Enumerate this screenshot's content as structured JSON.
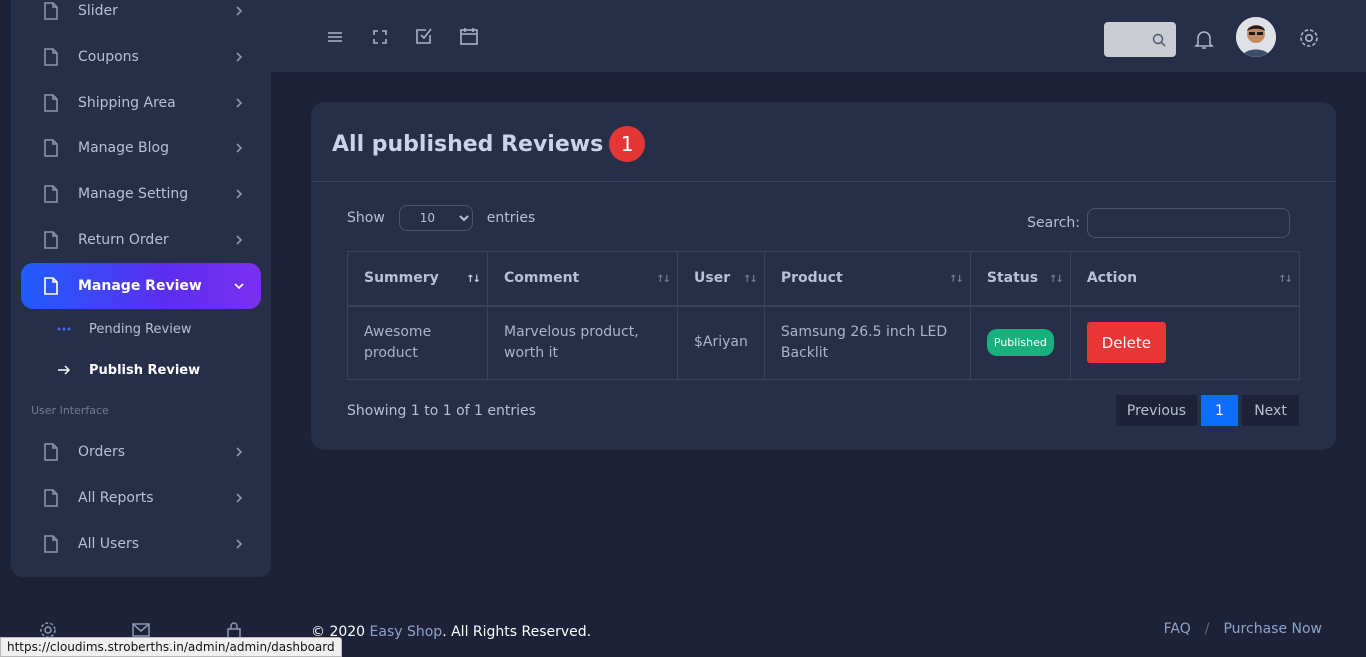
{
  "sidebar": {
    "items": [
      {
        "label": "Slider"
      },
      {
        "label": "Coupons"
      },
      {
        "label": "Shipping Area"
      },
      {
        "label": "Manage Blog"
      },
      {
        "label": "Manage Setting"
      },
      {
        "label": "Return Order"
      },
      {
        "label": "Manage Review"
      }
    ],
    "sub_items": [
      {
        "label": "Pending Review"
      },
      {
        "label": "Publish Review"
      }
    ],
    "section_label": "User Interface",
    "items2": [
      {
        "label": "Orders"
      },
      {
        "label": "All Reports"
      },
      {
        "label": "All Users"
      }
    ]
  },
  "card": {
    "title": "All published Reviews",
    "count": "1",
    "show_label": "Show",
    "entries_label": "entries",
    "page_size": "10",
    "search_label": "Search:"
  },
  "table": {
    "headers": [
      "Summery",
      "Comment",
      "User",
      "Product",
      "Status",
      "Action"
    ],
    "rows": [
      {
        "summary": "Awesome product",
        "comment": "Marvelous product, worth it",
        "user": "$Ariyan",
        "product": "Samsung 26.5 inch LED Backlit",
        "status": "Published",
        "action": "Delete"
      }
    ]
  },
  "pagination": {
    "info": "Showing 1 to 1 of 1 entries",
    "prev": "Previous",
    "current": "1",
    "next": "Next"
  },
  "footer": {
    "copy_prefix": "© 2020 ",
    "brand": "Easy Shop",
    "copy_suffix": ". All Rights Reserved.",
    "faq": "FAQ",
    "sep": "/",
    "purchase": "Purchase Now"
  },
  "status_url": "https://cloudims.stroberths.in/admin/admin/dashboard",
  "colors": {
    "accent": "#0d6efd",
    "danger": "#e83535",
    "success": "#18b07e",
    "sidebar_bg": "#272e48",
    "page_bg": "#1d2238"
  }
}
